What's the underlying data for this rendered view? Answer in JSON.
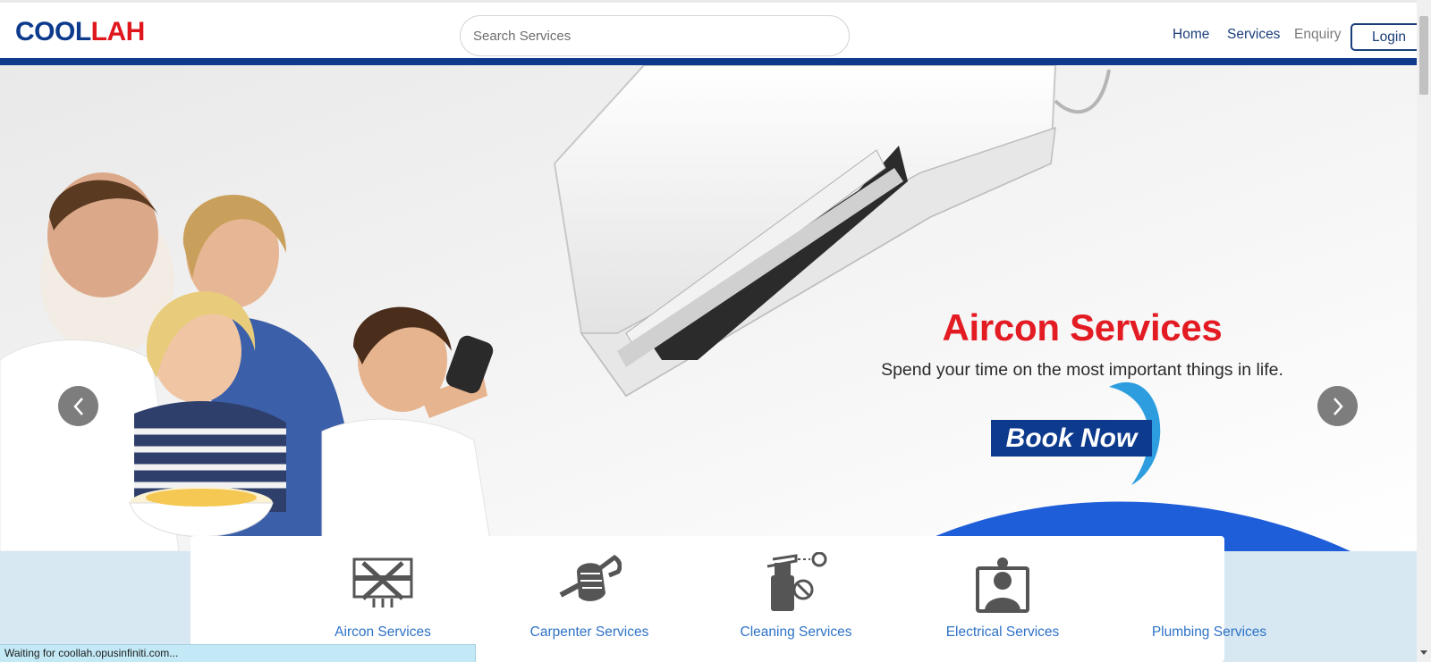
{
  "header": {
    "logo_part1": "COOL",
    "logo_part2": "LAH",
    "search_placeholder": "Search Services",
    "nav": {
      "home": "Home",
      "services": "Services",
      "enquiry": "Enquiry",
      "login": "Login"
    }
  },
  "hero": {
    "title": "Aircon Services",
    "subtitle": "Spend your time on the most important things in life.",
    "cta": "Book Now",
    "prev_icon": "chevron-left-icon",
    "next_icon": "chevron-right-icon"
  },
  "services": [
    {
      "label": "Aircon Services",
      "icon": "aircon-tools-icon"
    },
    {
      "label": "Carpenter Services",
      "icon": "fist-wrench-icon"
    },
    {
      "label": "Cleaning Services",
      "icon": "spray-bottle-icon"
    },
    {
      "label": "Electrical Services",
      "icon": "electrician-icon"
    },
    {
      "label": "Plumbing Services",
      "icon": ""
    }
  ],
  "status": "Waiting for coollah.opusinfiniti.com...",
  "colors": {
    "brand_blue": "#0d3a8c",
    "brand_red": "#e0161d",
    "link_blue": "#2e72c7",
    "page_bg": "#d7e8f3"
  }
}
